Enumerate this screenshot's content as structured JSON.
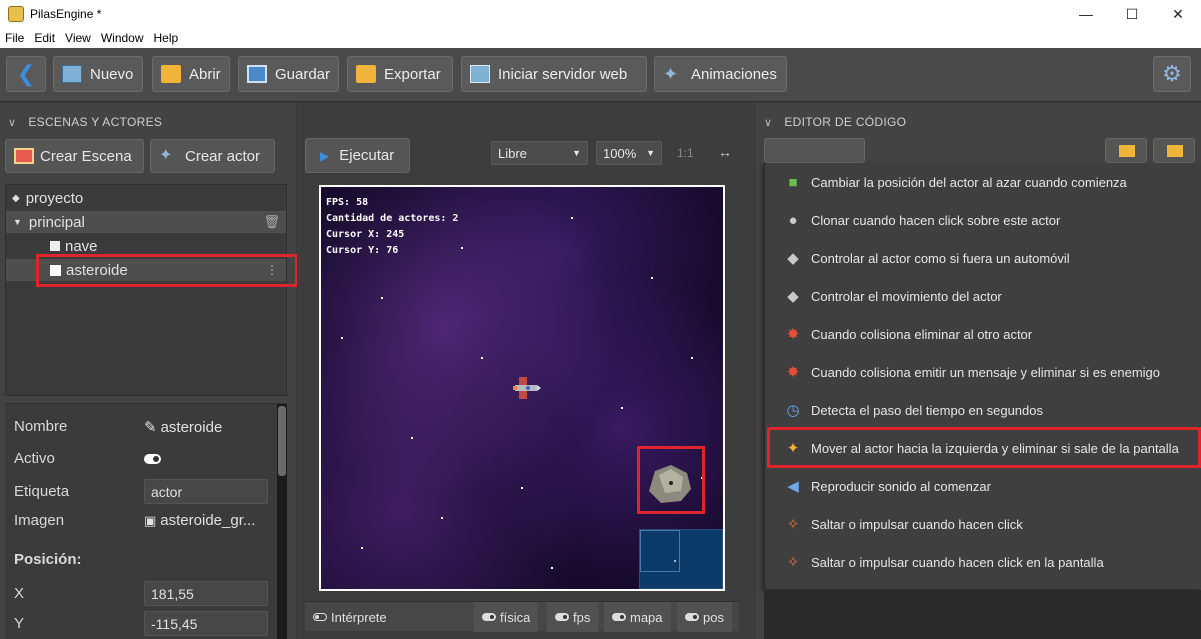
{
  "window": {
    "title": "PilasEngine *",
    "controls": [
      "—",
      "☐",
      "✕"
    ]
  },
  "menubar": [
    "File",
    "Edit",
    "View",
    "Window",
    "Help"
  ],
  "toolbar": {
    "back": "❮",
    "nuevo": "Nuevo",
    "abrir": "Abrir",
    "guardar": "Guardar",
    "exportar": "Exportar",
    "servidor": "Iniciar servidor web",
    "animaciones": "Animaciones",
    "settings": "⚙"
  },
  "left": {
    "title": "ESCENAS Y ACTORES",
    "crear_escena": "Crear Escena",
    "crear_actor": "Crear actor",
    "tree": {
      "project": "proyecto",
      "scene": "principal",
      "actor1": "nave",
      "actor2": "asteroide"
    },
    "props": {
      "nombre_label": "Nombre",
      "nombre_value": "asteroide",
      "activo_label": "Activo",
      "etiqueta_label": "Etiqueta",
      "etiqueta_value": "actor",
      "imagen_label": "Imagen",
      "imagen_value": "asteroide_gr...",
      "posicion_label": "Posición:",
      "x_label": "X",
      "x_value": "181,55",
      "y_label": "Y",
      "y_value": "-115,45"
    }
  },
  "center": {
    "ejecutar": "Ejecutar",
    "mode": "Libre",
    "zoom": "100%",
    "ratio": "1:1",
    "expand": "↔",
    "hud": {
      "fps": "FPS: 58",
      "actors": "Cantidad de actores: 2",
      "cursor_x": "Cursor X: 245",
      "cursor_y": "Cursor Y: 76"
    },
    "status": {
      "interprete": "Intérprete",
      "fisica": "física",
      "fps": "fps",
      "mapa": "mapa",
      "pos": "pos"
    }
  },
  "right": {
    "title": "EDITOR DE CÓDIGO",
    "menu_items": [
      "Cambiar la posición del actor al azar cuando comienza",
      "Clonar cuando hacen click sobre este actor",
      "Controlar al actor como si fuera un automóvil",
      "Controlar el movimiento del actor",
      "Cuando colisiona eliminar al otro actor",
      "Cuando colisiona emitir un mensaje y eliminar si es enemigo",
      "Detecta el paso del tiempo en segundos",
      "Mover al actor hacia la izquierda y eliminar si sale de la pantalla",
      "Reproducir sonido al comenzar",
      "Saltar o impulsar cuando hacen click",
      "Saltar o impulsar cuando hacen click en la pantalla"
    ]
  },
  "colors": {
    "highlight": "#e0242b",
    "accent": "#3b8fe0"
  }
}
